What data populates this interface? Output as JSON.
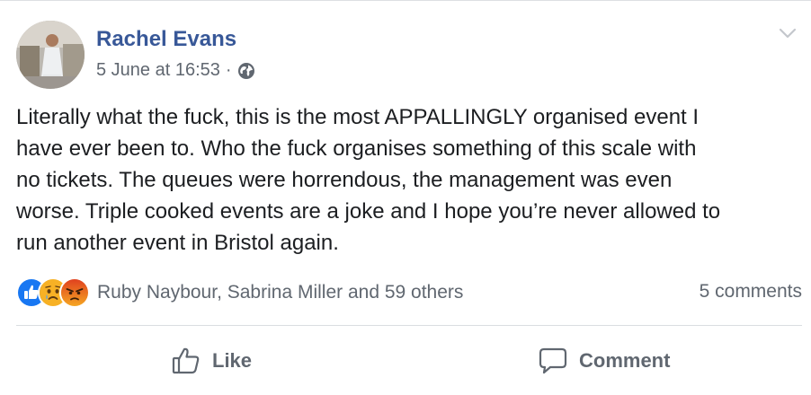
{
  "post": {
    "author": "Rachel Evans",
    "timestamp": "5 June at 16:53",
    "separator": "·",
    "privacy_icon": "globe-icon",
    "menu_icon": "chevron-down-icon",
    "text": "Literally what the fuck, this is the most APPALLINGLY organised event I\nhave ever been to. Who the fuck organises something of this scale with\nno tickets. The queues were horrendous, the management was even\nworse. Triple cooked events are a joke and I hope you’re never allowed to\nrun another event in Bristol again."
  },
  "reactions": {
    "icons": [
      "like-reaction-icon",
      "sad-reaction-icon",
      "angry-reaction-icon"
    ],
    "summary": "Ruby Naybour, Sabrina Miller and 59 others",
    "comments": "5 comments"
  },
  "actions": {
    "like_label": "Like",
    "like_icon": "thumbs-up-icon",
    "comment_label": "Comment",
    "comment_icon": "speech-bubble-icon"
  },
  "colors": {
    "author_link": "#385898",
    "secondary_text": "#606770",
    "like_blue": "#1877f2",
    "sad_yellow": "#f7b125",
    "angry_orange": "#e9710f",
    "divider": "#dadde1"
  }
}
